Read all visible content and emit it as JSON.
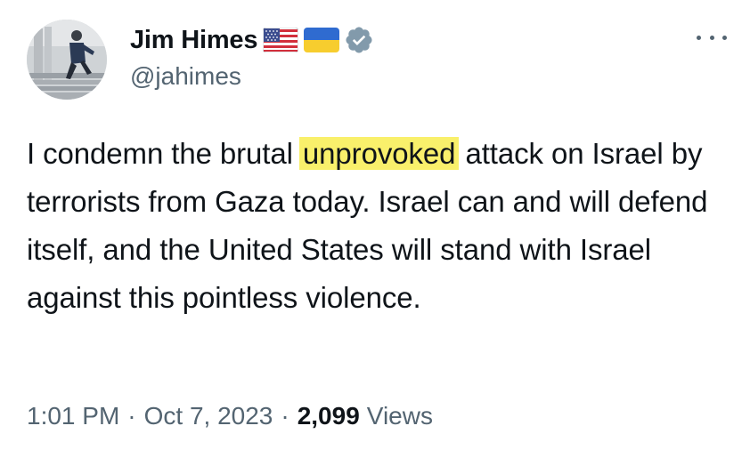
{
  "author": {
    "display_name": "Jim Himes",
    "handle": "@jahimes",
    "badges": [
      "us-flag-icon",
      "ukraine-flag-icon",
      "verified-badge-icon"
    ]
  },
  "tweet": {
    "text_before": "I condemn the brutal ",
    "highlighted": "unprovoked",
    "text_after": " attack on Israel by terrorists from Gaza today. Israel can and will defend itself, and the United States will stand with Israel against this pointless violence.",
    "highlight_color": "#f9f06b"
  },
  "meta": {
    "time": "1:01 PM",
    "separator": "·",
    "date": "Oct 7, 2023",
    "views_count": "2,099",
    "views_label": "Views"
  },
  "colors": {
    "text": "#0f1419",
    "secondary": "#536471",
    "verified": "#829aab"
  }
}
